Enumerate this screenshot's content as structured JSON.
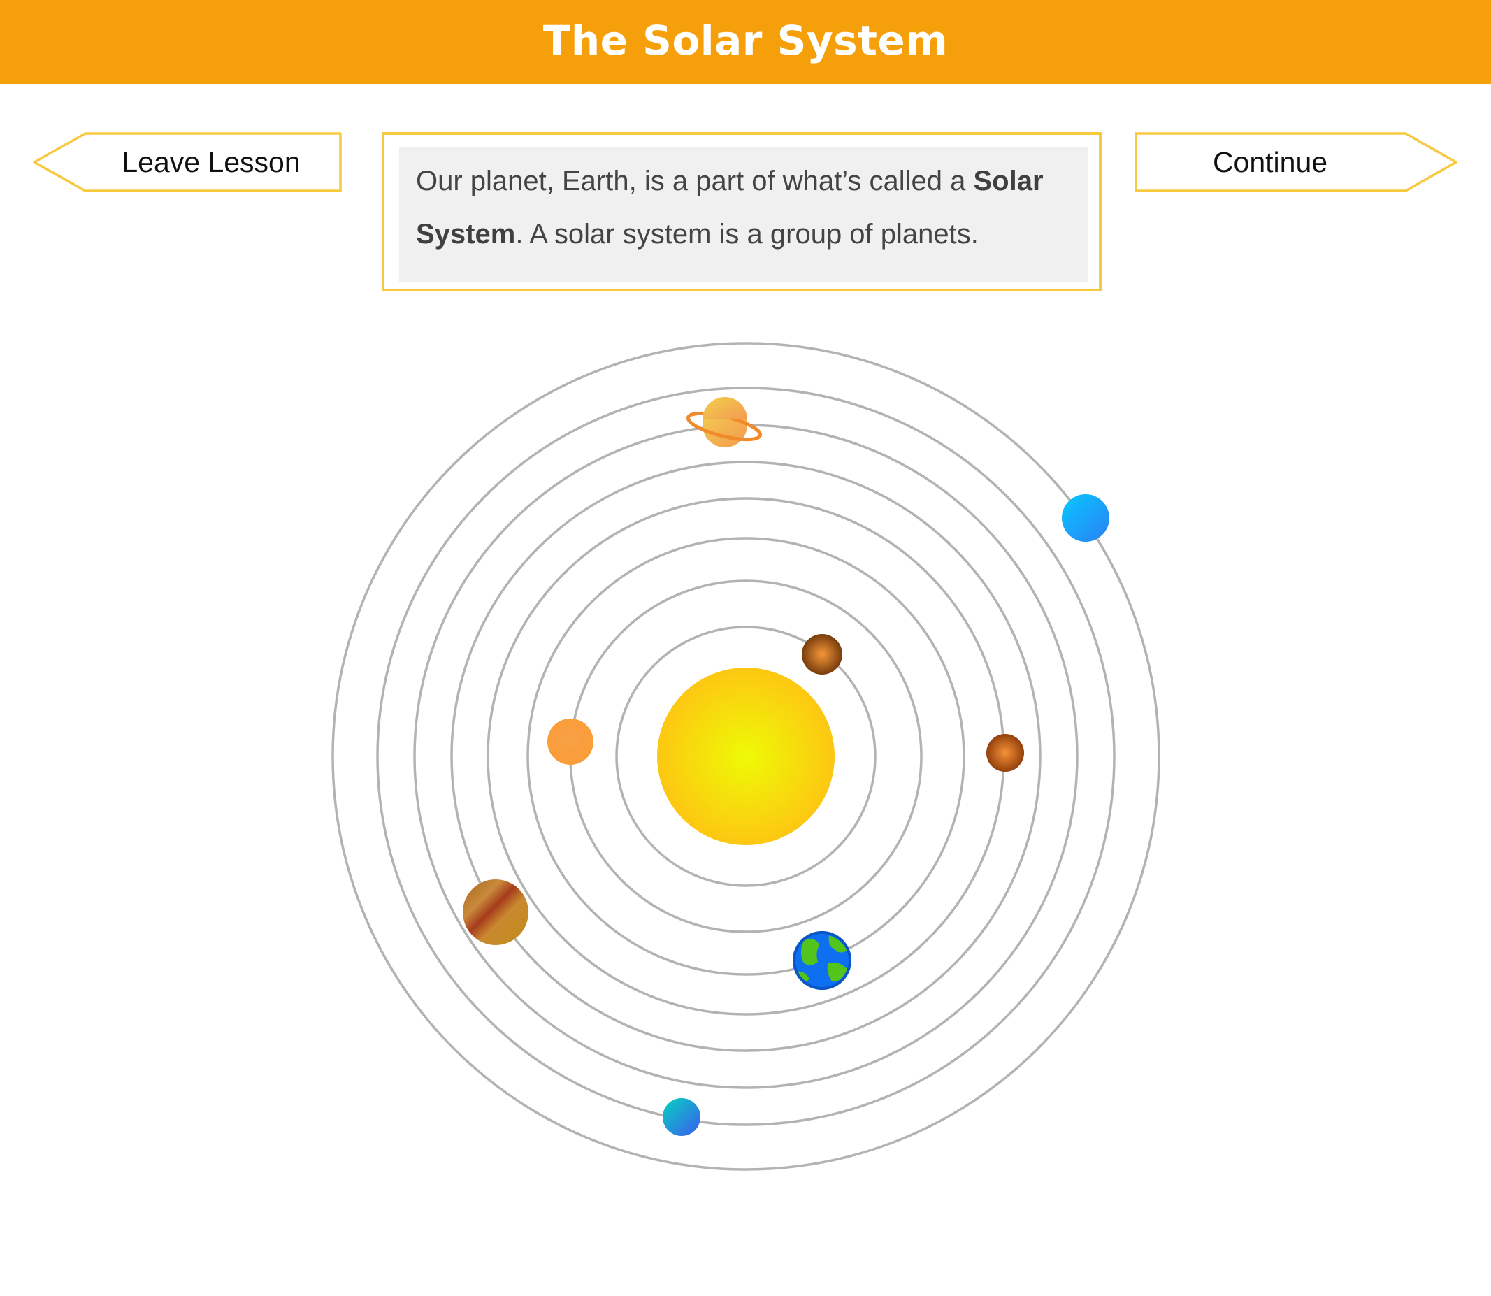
{
  "header": {
    "title": "The Solar System",
    "background_color": "#f5a00a"
  },
  "navigation": {
    "leave_label": "Leave Lesson",
    "continue_label": "Continue",
    "button_border_color": "#f7c93e"
  },
  "lesson_text": {
    "part1": "Our planet, Earth, is a part of what’s called a ",
    "bold": "Solar System",
    "part2": ". A solar system is a group of planets."
  },
  "diagram": {
    "center": "sun",
    "orbit_count": 8,
    "bodies": [
      {
        "name": "sun",
        "icon": "sun-icon"
      },
      {
        "name": "mercury",
        "icon": "mercury-icon"
      },
      {
        "name": "venus",
        "icon": "venus-icon"
      },
      {
        "name": "earth",
        "icon": "earth-icon"
      },
      {
        "name": "mars",
        "icon": "mars-icon"
      },
      {
        "name": "jupiter",
        "icon": "jupiter-icon"
      },
      {
        "name": "saturn",
        "icon": "saturn-icon"
      },
      {
        "name": "uranus",
        "icon": "uranus-icon"
      },
      {
        "name": "neptune",
        "icon": "neptune-icon"
      }
    ]
  }
}
